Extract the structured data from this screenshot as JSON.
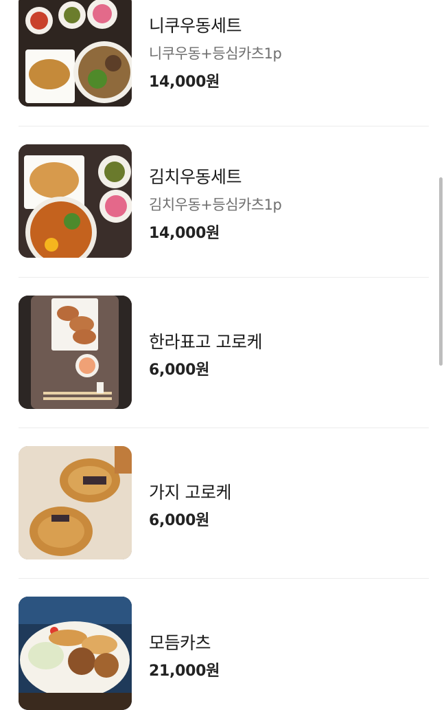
{
  "menu": {
    "items": [
      {
        "name": "니쿠우동세트",
        "description": "니쿠우동+등심카츠1p",
        "price": "14,000원",
        "image": "niku-udon-set-photo"
      },
      {
        "name": "김치우동세트",
        "description": "김치우동+등심카츠1p",
        "price": "14,000원",
        "image": "kimchi-udon-set-photo"
      },
      {
        "name": "한라표고 고로케",
        "price": "6,000원",
        "image": "shiitake-croquette-photo"
      },
      {
        "name": "가지 고로케",
        "price": "6,000원",
        "image": "eggplant-croquette-photo"
      },
      {
        "name": "모듬카츠",
        "price": "21,000원",
        "image": "assorted-katsu-photo"
      }
    ]
  }
}
